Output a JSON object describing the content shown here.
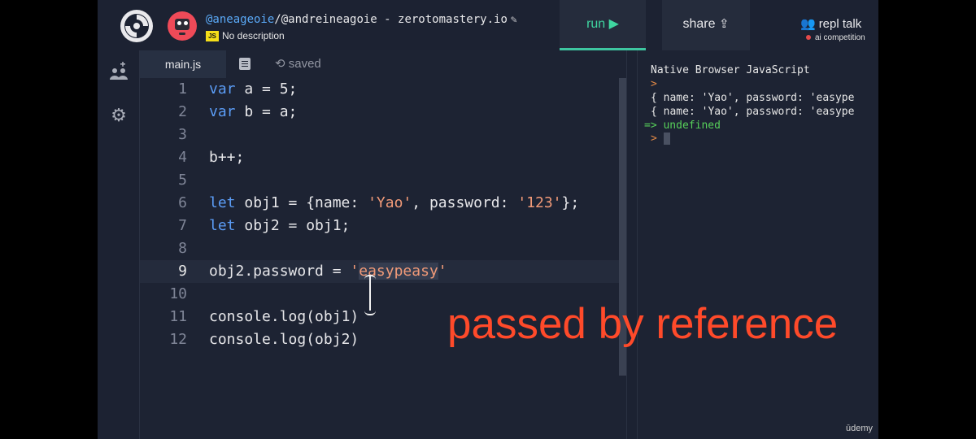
{
  "header": {
    "user": "@aneageoie",
    "repl_path": "/@andreineagoie - zerotomastery.io",
    "description": "No description",
    "lang_badge": "JS",
    "run_label": "run ▶",
    "share_label": "share",
    "repl_talk_label": "repl talk",
    "ai_competition_label": "ai competition"
  },
  "editor": {
    "tab_label": "main.js",
    "saved_label": "saved",
    "line_numbers": [
      "1",
      "2",
      "3",
      "4",
      "5",
      "6",
      "7",
      "8",
      "9",
      "10",
      "11",
      "12"
    ],
    "lines": {
      "l1": {
        "kw": "var",
        "rest": " a = 5;"
      },
      "l2": {
        "kw": "var",
        "rest": " b = a;"
      },
      "l4": "b++;",
      "l6": {
        "kw": "let",
        "pre": " obj1 = {name: ",
        "s1": "'Yao'",
        "mid": ", password: ",
        "s2": "'123'",
        "post": "};"
      },
      "l7": {
        "kw": "let",
        "rest": " obj2 = obj1;"
      },
      "l9": {
        "pre": "obj2.password = ",
        "q1": "'",
        "sel": "easypeasy",
        "q2": "'"
      },
      "l11": {
        "obj": "console.",
        "fn": "log",
        "args": "(obj1)"
      },
      "l12": {
        "obj": "console.",
        "fn": "log",
        "args": "(obj2)"
      }
    }
  },
  "console": {
    "title": "Native Browser JavaScript",
    "prompt": ">",
    "out1": "{ name: 'Yao', password: 'easype",
    "out2": "{ name: 'Yao', password: 'easype",
    "result_arrow": "=>",
    "result": "undefined"
  },
  "overlay": {
    "caption": "passed by reference",
    "watermark": "ūdemy"
  },
  "colors": {
    "accent_run": "#3fd6a0",
    "keyword": "#5b9cf5",
    "string": "#f19a78",
    "caption": "#ff4a2a"
  }
}
